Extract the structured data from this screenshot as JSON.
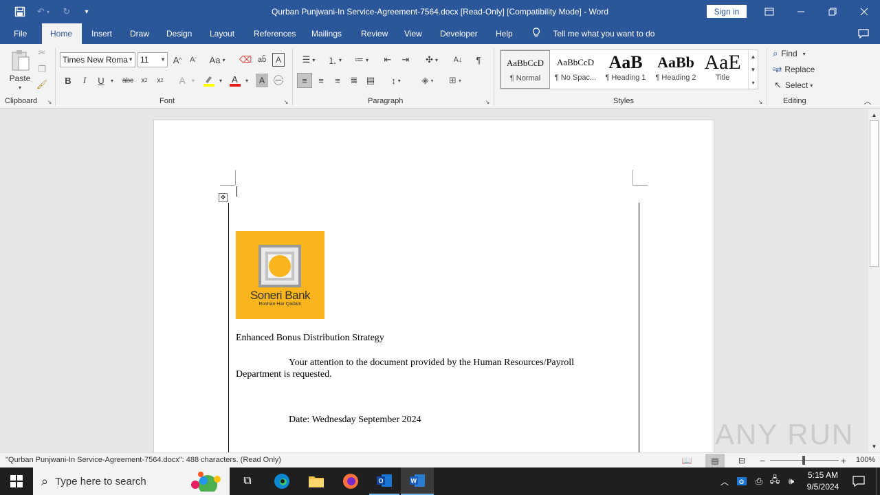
{
  "title_bar": {
    "doc_title": "Qurban Punjwani-In Service-Agreement-7564.docx [Read-Only] [Compatibility Mode]  -  Word",
    "sign_in": "Sign in"
  },
  "tabs": [
    "File",
    "Home",
    "Insert",
    "Draw",
    "Design",
    "Layout",
    "References",
    "Mailings",
    "Review",
    "View",
    "Developer",
    "Help"
  ],
  "active_tab": "Home",
  "tell_me": "Tell me what you want to do",
  "ribbon": {
    "clipboard": {
      "paste": "Paste",
      "label": "Clipboard"
    },
    "font": {
      "name": "Times New Roma",
      "size": "11",
      "label": "Font",
      "change_case": "Aa"
    },
    "paragraph": {
      "label": "Paragraph"
    },
    "styles": {
      "label": "Styles",
      "items": [
        {
          "preview": "AaBbCcD",
          "name": "¶ Normal"
        },
        {
          "preview": "AaBbCcD",
          "name": "¶ No Spac..."
        },
        {
          "preview": "AaB",
          "name": "¶ Heading 1"
        },
        {
          "preview": "AaBb",
          "name": "¶ Heading 2"
        },
        {
          "preview": "AaE",
          "name": "Title"
        }
      ]
    },
    "editing": {
      "find": "Find",
      "replace": "Replace",
      "select": "Select",
      "label": "Editing"
    }
  },
  "document": {
    "logo": {
      "name": "Soneri Bank",
      "tagline": "Roshan Har Qadam",
      "bg_color": "#f9b51b",
      "circle_color": "#f9b51b"
    },
    "heading": "Enhanced Bonus Distribution Strategy",
    "para_line1": "Your attention to the document provided by the Human Resources/Payroll",
    "para_line2": "Department is requested.",
    "date_line": "Date: Wednesday September 2024"
  },
  "status": {
    "text": "\"Qurban Punjwani-In Service-Agreement-7564.docx\": 488 characters.  (Read Only)",
    "zoom": "100%"
  },
  "watermark": "ANY RUN",
  "taskbar": {
    "search_placeholder": "Type here to search",
    "time": "5:15 AM",
    "date": "9/5/2024"
  },
  "colors": {
    "brand": "#2b579a",
    "ribbon_bg": "#f3f3f3",
    "taskbar": "#1f1f1f"
  }
}
